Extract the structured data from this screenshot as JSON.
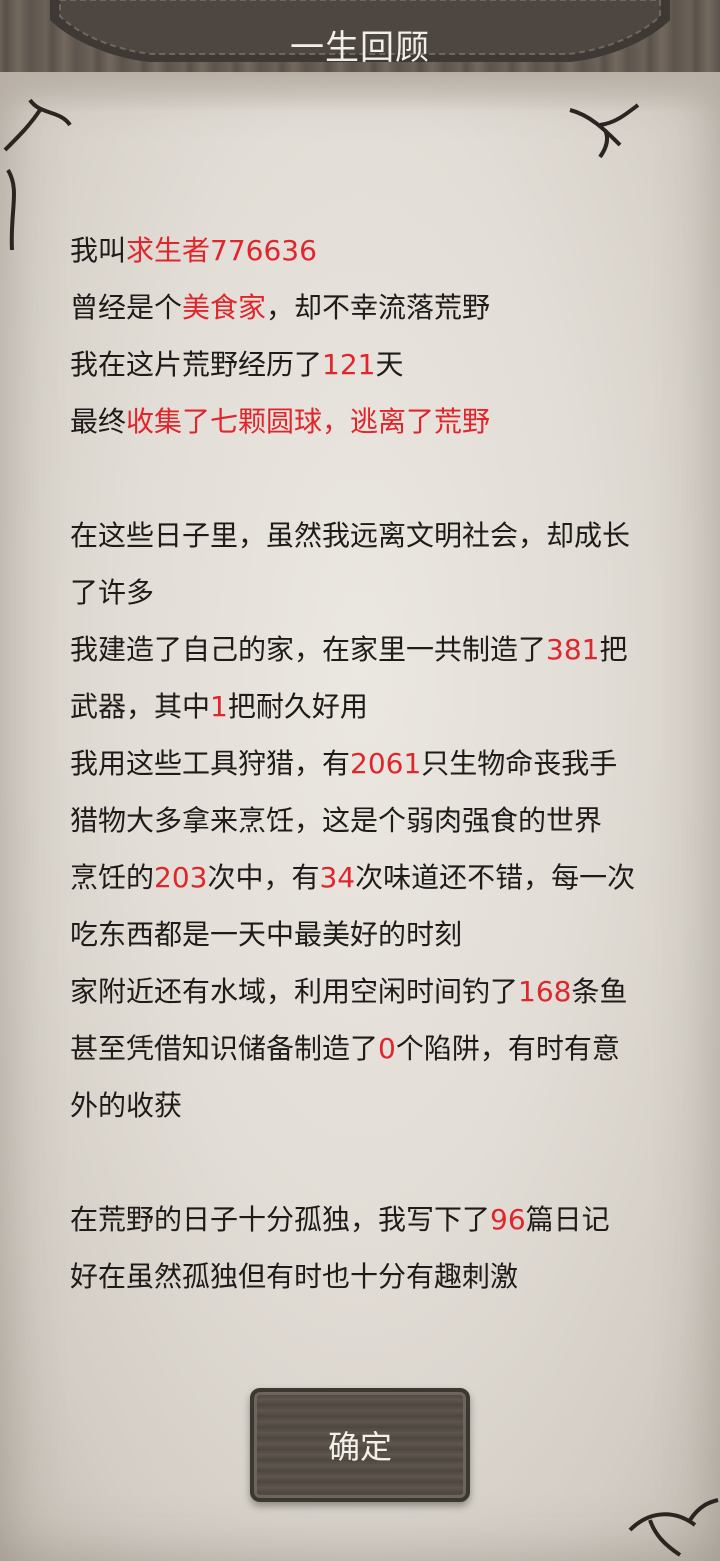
{
  "header": {
    "title": "一生回顾"
  },
  "content": {
    "paragraphs": [
      {
        "lines": [
          [
            {
              "t": "我叫"
            },
            {
              "t": "求生者776636",
              "hl": true
            }
          ],
          [
            {
              "t": "曾经是个"
            },
            {
              "t": "美食家",
              "hl": true
            },
            {
              "t": "，却不幸流落荒野"
            }
          ],
          [
            {
              "t": "我在这片荒野经历了"
            },
            {
              "t": "121",
              "hl": true
            },
            {
              "t": "天"
            }
          ],
          [
            {
              "t": "最终"
            },
            {
              "t": "收集了七颗圆球，逃离了荒野",
              "hl": true
            }
          ]
        ]
      },
      {
        "lines": [
          [
            {
              "t": "在这些日子里，虽然我远离文明社会，却成长"
            }
          ],
          [
            {
              "t": "了许多"
            }
          ],
          [
            {
              "t": "我建造了自己的家，在家里一共制造了"
            },
            {
              "t": "381",
              "hl": true
            },
            {
              "t": "把"
            }
          ],
          [
            {
              "t": "武器，其中"
            },
            {
              "t": "1",
              "hl": true
            },
            {
              "t": "把耐久好用"
            }
          ],
          [
            {
              "t": "我用这些工具狩猎，有"
            },
            {
              "t": "2061",
              "hl": true
            },
            {
              "t": "只生物命丧我手"
            }
          ],
          [
            {
              "t": "猎物大多拿来烹饪，这是个弱肉强食的世界"
            }
          ],
          [
            {
              "t": "烹饪的"
            },
            {
              "t": "203",
              "hl": true
            },
            {
              "t": "次中，有"
            },
            {
              "t": "34",
              "hl": true
            },
            {
              "t": "次味道还不错，每一次"
            }
          ],
          [
            {
              "t": "吃东西都是一天中最美好的时刻"
            }
          ],
          [
            {
              "t": "家附近还有水域，利用空闲时间钓了"
            },
            {
              "t": "168",
              "hl": true
            },
            {
              "t": "条鱼"
            }
          ],
          [
            {
              "t": "甚至凭借知识储备制造了"
            },
            {
              "t": "0",
              "hl": true
            },
            {
              "t": "个陷阱，有时有意"
            }
          ],
          [
            {
              "t": "外的收获"
            }
          ]
        ]
      },
      {
        "lines": [
          [
            {
              "t": "在荒野的日子十分孤独，我写下了"
            },
            {
              "t": "96",
              "hl": true
            },
            {
              "t": "篇日记"
            }
          ],
          [
            {
              "t": "好在虽然孤独但有时也十分有趣刺激"
            }
          ]
        ]
      }
    ]
  },
  "footer": {
    "confirm_label": "确定"
  },
  "colors": {
    "highlight": "#e0262c",
    "text": "#1e1b19",
    "paper": "#e2ddd6",
    "header_leather": "#4a4440"
  }
}
